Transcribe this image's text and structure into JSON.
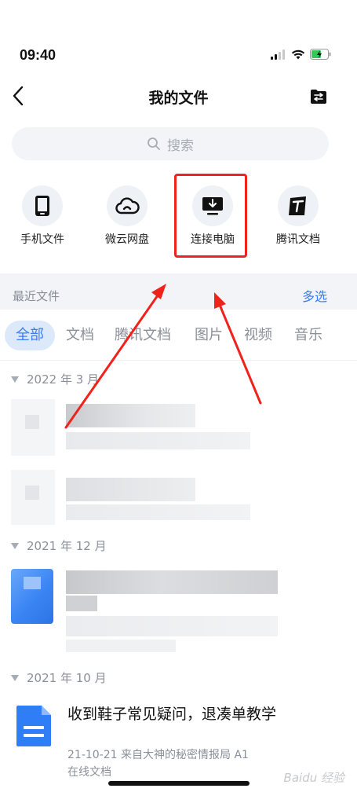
{
  "status": {
    "time": "09:40"
  },
  "nav": {
    "title": "我的文件"
  },
  "search": {
    "placeholder": "搜索"
  },
  "quick_actions": [
    {
      "label": "手机文件",
      "icon": "phone-icon"
    },
    {
      "label": "微云网盘",
      "icon": "cloud-icon"
    },
    {
      "label": "连接电脑",
      "icon": "computer-download-icon"
    },
    {
      "label": "腾讯文档",
      "icon": "tencent-docs-icon"
    }
  ],
  "recent": {
    "title": "最近文件",
    "multi_select": "多选"
  },
  "tabs": [
    "全部",
    "文档",
    "腾讯文档",
    "图片",
    "视频",
    "音乐"
  ],
  "groups": [
    {
      "label": "2022 年 3 月"
    },
    {
      "label": "2021 年 12 月"
    },
    {
      "label": "2021 年 10 月"
    }
  ],
  "file": {
    "title": "收到鞋子常见疑问，退凑单教学",
    "meta": "21-10-21 来自大神的秘密情报局 A1",
    "type": "在线文档"
  },
  "watermark": "Baidu 经验",
  "colors": {
    "accent": "#3a7cf5",
    "highlight": "#f0231c",
    "doc_blue": "#2f7ef5"
  }
}
